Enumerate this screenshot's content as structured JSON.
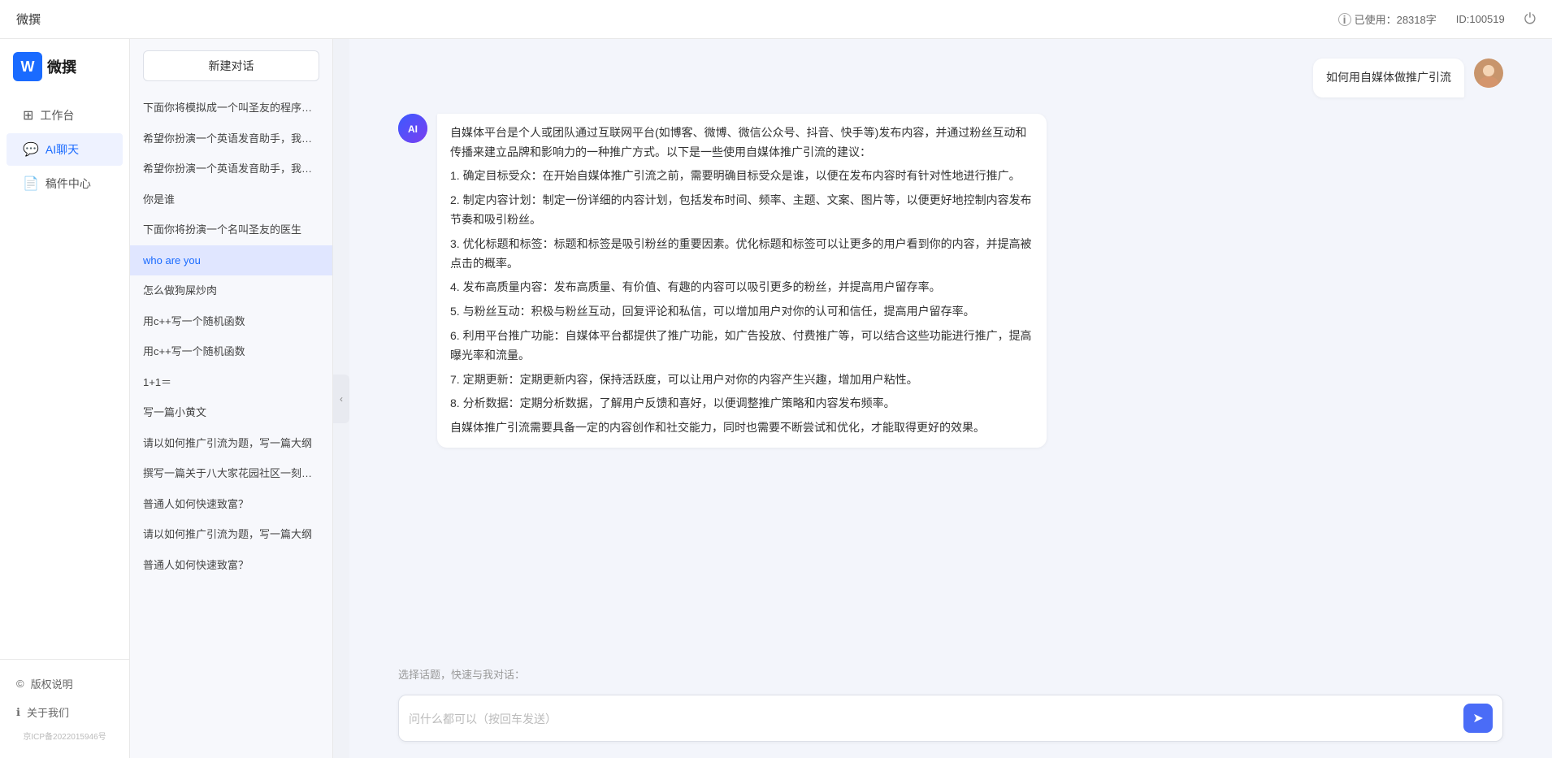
{
  "topbar": {
    "title": "微撰",
    "usage_label": "已使用：28318字",
    "usage_icon": "i-icon",
    "id_label": "ID:100519",
    "power_label": "⏻"
  },
  "sidebar": {
    "logo_text": "微撰",
    "nav_items": [
      {
        "id": "workspace",
        "label": "工作台",
        "icon": "⊞"
      },
      {
        "id": "ai-chat",
        "label": "AI聊天",
        "icon": "💬",
        "active": true
      },
      {
        "id": "draft",
        "label": "稿件中心",
        "icon": "📄"
      }
    ],
    "bottom_items": [
      {
        "id": "copyright",
        "label": "版权说明",
        "icon": "©"
      },
      {
        "id": "about",
        "label": "关于我们",
        "icon": "ℹ"
      }
    ],
    "icp": "京ICP备2022015946号"
  },
  "chat_list": {
    "new_chat_label": "新建对话",
    "items": [
      {
        "id": "c1",
        "text": "下面你将模拟成一个叫圣友的程序员，我说..."
      },
      {
        "id": "c2",
        "text": "希望你扮演一个英语发音助手，我提供给你..."
      },
      {
        "id": "c3",
        "text": "希望你扮演一个英语发音助手，我提供给你..."
      },
      {
        "id": "c4",
        "text": "你是谁"
      },
      {
        "id": "c5",
        "text": "下面你将扮演一个名叫圣友的医生"
      },
      {
        "id": "c6",
        "text": "who are you",
        "active": true
      },
      {
        "id": "c7",
        "text": "怎么做狗屎炒肉"
      },
      {
        "id": "c8",
        "text": "用c++写一个随机函数"
      },
      {
        "id": "c9",
        "text": "用c++写一个随机函数"
      },
      {
        "id": "c10",
        "text": "1+1＝"
      },
      {
        "id": "c11",
        "text": "写一篇小黄文"
      },
      {
        "id": "c12",
        "text": "请以如何推广引流为题，写一篇大纲"
      },
      {
        "id": "c13",
        "text": "撰写一篇关于八大家花园社区一刻钟便民生..."
      },
      {
        "id": "c14",
        "text": "普通人如何快速致富？"
      },
      {
        "id": "c15",
        "text": "请以如何推广引流为题，写一篇大纲"
      },
      {
        "id": "c16",
        "text": "普通人如何快速致富？"
      }
    ]
  },
  "chat": {
    "messages": [
      {
        "id": "m1",
        "role": "user",
        "avatar_type": "user",
        "text": "如何用自媒体做推广引流"
      },
      {
        "id": "m2",
        "role": "assistant",
        "avatar_type": "ai",
        "avatar_label": "AI",
        "paragraphs": [
          "自媒体平台是个人或团队通过互联网平台(如博客、微博、微信公众号、抖音、快手等)发布内容，并通过粉丝互动和传播来建立品牌和影响力的一种推广方式。以下是一些使用自媒体推广引流的建议：",
          "1. 确定目标受众：在开始自媒体推广引流之前，需要明确目标受众是谁，以便在发布内容时有针对性地进行推广。",
          "2. 制定内容计划：制定一份详细的内容计划，包括发布时间、频率、主题、文案、图片等，以便更好地控制内容发布节奏和吸引粉丝。",
          "3. 优化标题和标签：标题和标签是吸引粉丝的重要因素。优化标题和标签可以让更多的用户看到你的内容，并提高被点击的概率。",
          "4. 发布高质量内容：发布高质量、有价值、有趣的内容可以吸引更多的粉丝，并提高用户留存率。",
          "5. 与粉丝互动：积极与粉丝互动，回复评论和私信，可以增加用户对你的认可和信任，提高用户留存率。",
          "6. 利用平台推广功能：自媒体平台都提供了推广功能，如广告投放、付费推广等，可以结合这些功能进行推广，提高曝光率和流量。",
          "7. 定期更新：定期更新内容，保持活跃度，可以让用户对你的内容产生兴趣，增加用户粘性。",
          "8. 分析数据：定期分析数据，了解用户反馈和喜好，以便调整推广策略和内容发布频率。",
          "自媒体推广引流需要具备一定的内容创作和社交能力，同时也需要不断尝试和优化，才能取得更好的效果。"
        ]
      }
    ],
    "quick_topics_label": "选择话题，快速与我对话：",
    "input_placeholder": "问什么都可以（按回车发送）"
  }
}
